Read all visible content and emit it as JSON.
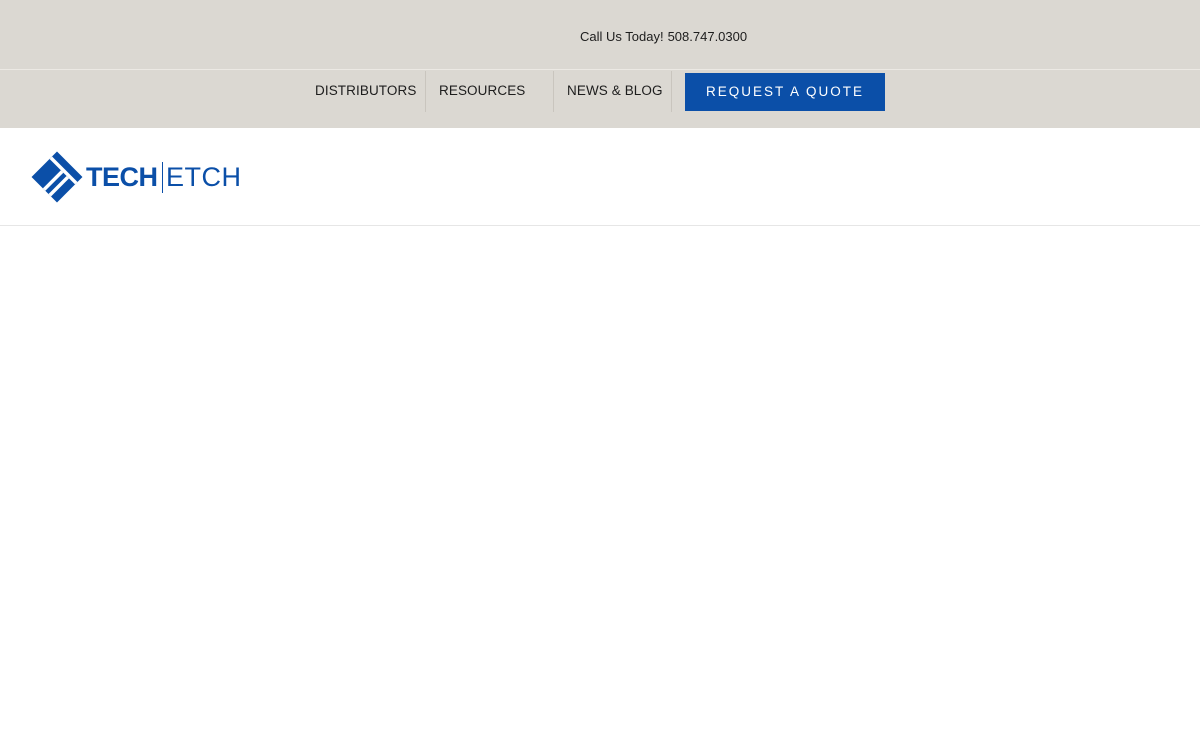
{
  "topbar": {
    "call_label": "Call Us Today!",
    "phone": "508.747.0300"
  },
  "nav": {
    "items": [
      {
        "label": "DISTRIBUTORS"
      },
      {
        "label": "RESOURCES"
      },
      {
        "label": "NEWS & BLOG"
      }
    ],
    "cta_label": "REQUEST A QUOTE"
  },
  "brand": {
    "name_bold": "TECH",
    "name_light": "ETCH",
    "logo_icon": "diamond-stripes-icon",
    "color": "#0b4fa8"
  },
  "colors": {
    "topbar_bg": "#dbd8d2",
    "accent": "#0b4fa8"
  }
}
